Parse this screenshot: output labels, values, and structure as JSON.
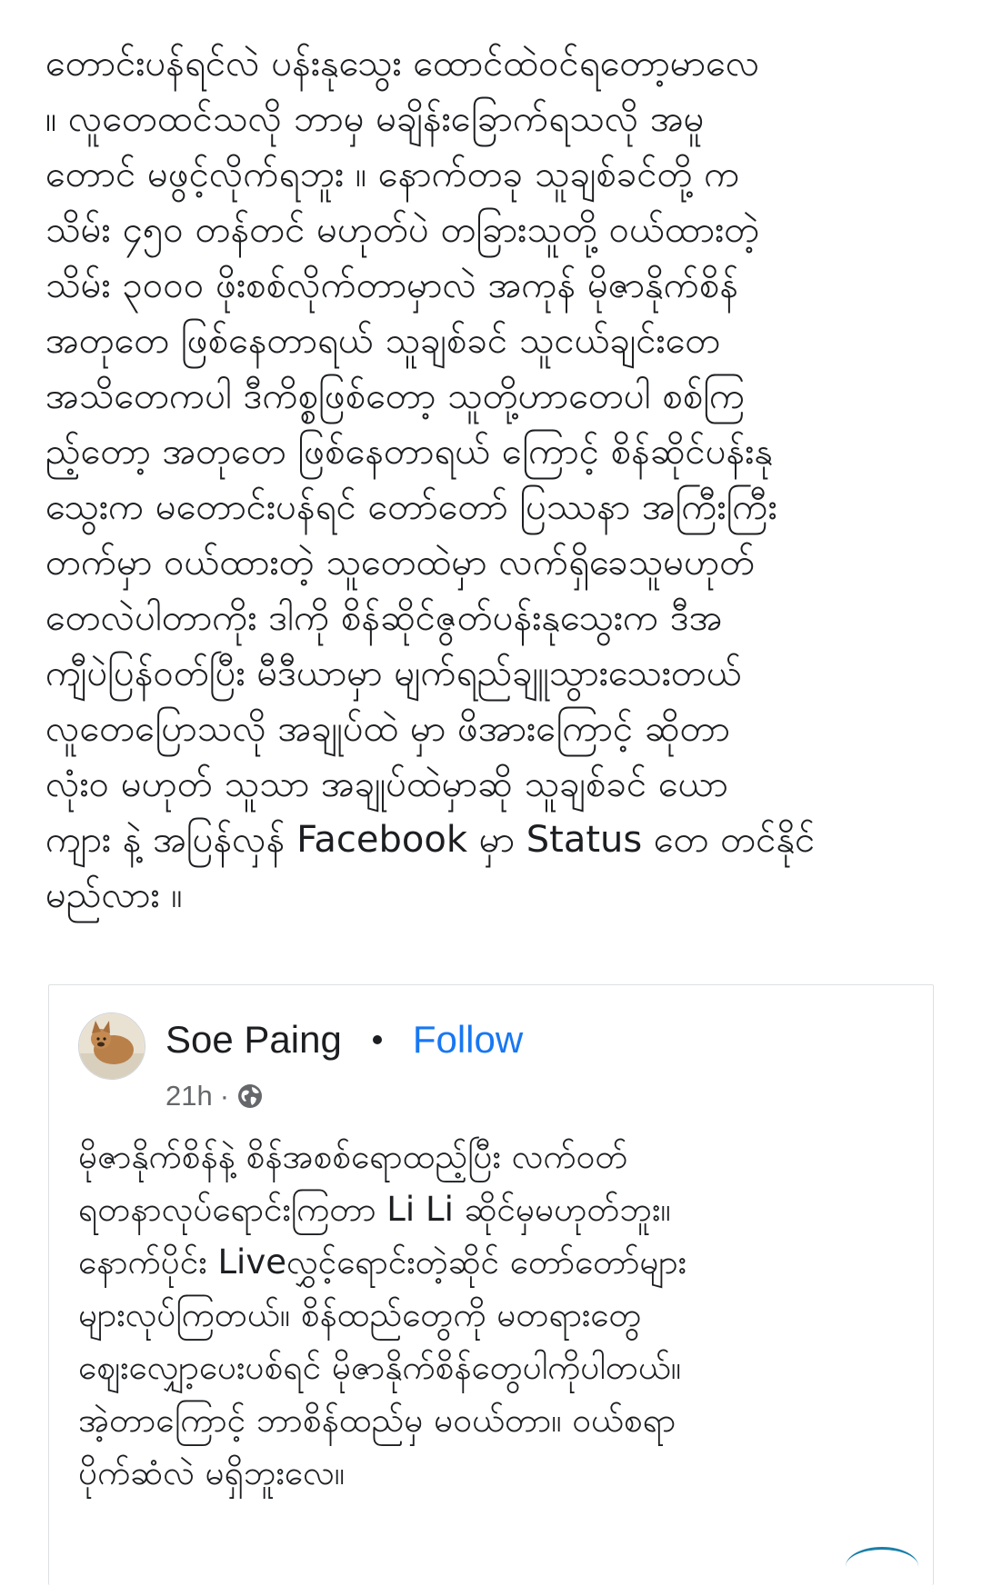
{
  "post": {
    "lines": [
      "တောင်းပန်ရင်လဲ ပန်းနုသွေး ထောင်ထဲဝင်ရတော့မာလေ",
      "။ လူတေထင်သလို ဘာမှ မချိန်းခြောက်ရသလို အမူ",
      "တောင် မဖွင့်လိုက်ရဘူး ။ နောက်တခု သူချစ်ခင်တို့ က",
      "သိမ်း ၄၅၀ တန်တင် မဟုတ်ပဲ တခြားသူတို့ ဝယ်ထားတဲ့",
      "သိမ်း ၃၀၀၀ ဖိုးစစ်လိုက်တာမှာလဲ အကုန် မိုဇာနိုက်စိန်",
      "အတုတေ ဖြစ်နေတာရယ်  သူချစ်ခင် သူငယ်ချင်းတေ",
      "အသိတေကပါ ဒီကိစ္စဖြစ်တော့ သူတို့ဟာတေပါ စစ်ကြ",
      "ည့်တော့ အတုတေ ဖြစ်နေတာရယ် ကြောင့် စိန်ဆိုင်ပန်းနု",
      "သွေးက မတောင်းပန်ရင် တော်တော် ပြဿနာ အကြီးကြီး",
      "တက်မှာ ဝယ်ထားတဲ့ သူတေထဲမှာ လက်ရှိခေသူမဟုတ်",
      "တေလဲပါတာကိုး  ဒါကို စိန်ဆိုင်ဇွတ်ပန်းနုသွေးက ဒီအ",
      "ကျီပဲပြန်ဝတ်ပြီး မီဒီယာမှာ မျက်ရည်ချူသွားသေးတယ်",
      "လူတေပြောသလို အချုပ်ထဲ မှာ ဖိအားကြောင့် ဆိုတာ",
      "လုံးဝ မဟုတ် သူသာ အချုပ်ထဲမှာဆို သူချစ်ခင် ယော",
      "ကျား နဲ့  အပြန်လှန် Facebook မှာ Status တေ တင်နိုင်",
      "မည်လား ။"
    ]
  },
  "shared_post": {
    "author": "Soe Paing",
    "follow_label": "Follow",
    "time": "21h",
    "separator": "·",
    "privacy_icon": "globe-icon",
    "lines": [
      "မိုဇာနိုက်စိန်နဲ့ စိန်အစစ်ရောထည့်ပြီး လက်ဝတ်",
      "ရတနာလုပ်ရောင်းကြတာ Li Li ဆိုင်မှမဟုတ်ဘူး။",
      "နောက်ပိုင်း Liveလွှင့်ရောင်းတဲ့ဆိုင် တော်တော်များ",
      "များလုပ်ကြတယ်။ စိန်ထည်တွေကို မတရားတွေ",
      "ဈေးလျှော့ပေးပစ်ရင် မိုဇာနိုက်စိန်တွေပါကိုပါတယ်။",
      "အဲ့တာကြောင့် ဘာစိန်ထည်မှ မဝယ်တာ။ ဝယ်စရာ",
      "ပိုက်ဆံလဲ မရှိဘူးလေ။"
    ]
  },
  "colors": {
    "text": "#1c1e21",
    "follow": "#1877f2",
    "meta": "#65676b",
    "card_border": "#dddfe2"
  }
}
